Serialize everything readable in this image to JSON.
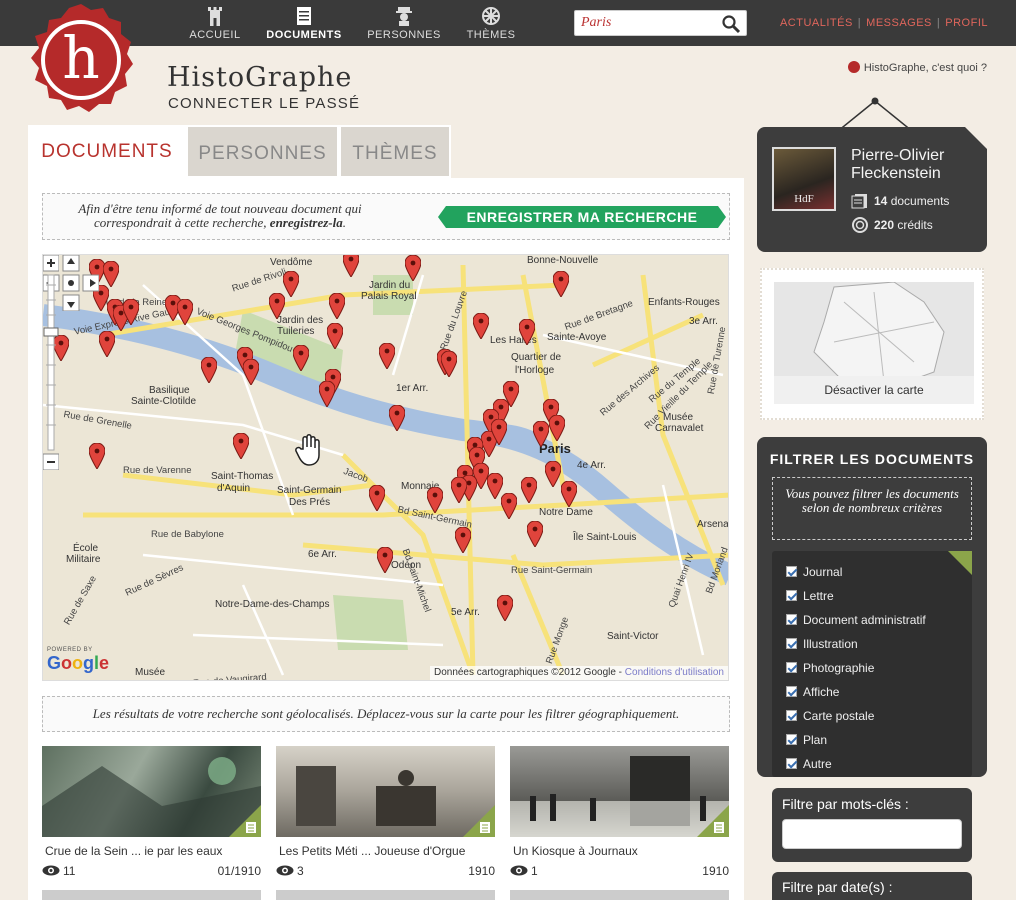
{
  "nav": {
    "items": [
      {
        "label": "ACCUEIL",
        "icon": "tower-icon"
      },
      {
        "label": "DOCUMENTS",
        "icon": "document-icon"
      },
      {
        "label": "PERSONNES",
        "icon": "person-icon"
      },
      {
        "label": "THÈMES",
        "icon": "wheel-icon"
      }
    ],
    "search_value": "Paris",
    "links": [
      "ACTUALITÉS",
      "MESSAGES",
      "PROFIL"
    ]
  },
  "header": {
    "logo_letter": "h",
    "title": "HistoGraphe",
    "subtitle": "CONNECTER LE PASSÉ",
    "whatis": "HistoGraphe, c'est quoi ?"
  },
  "tabs": [
    "DOCUMENTS",
    "PERSONNES",
    "THÈMES"
  ],
  "save": {
    "text_line1": "Afin d'être tenu informé de tout nouveau document qui",
    "text_line2": "correspondrait à cette recherche,",
    "text_emph": "enregistrez-la",
    "text_end": ".",
    "button": "ENREGISTRER MA RECHERCHE"
  },
  "map": {
    "labels": [
      {
        "t": "Vendôme",
        "c": "n"
      },
      {
        "t": "Jardin du",
        "c": "n"
      },
      {
        "t": "Palais Royal",
        "c": "n"
      },
      {
        "t": "Bonne-Nouvelle",
        "c": "n"
      },
      {
        "t": "Enfants-Rouges",
        "c": "n"
      },
      {
        "t": "3e Arr.",
        "c": "n"
      },
      {
        "t": "Sainte-Avoye",
        "c": "n"
      },
      {
        "t": "Les Halles",
        "c": "n"
      },
      {
        "t": "Quartier de",
        "c": "n"
      },
      {
        "t": "l'Horloge",
        "c": "n"
      },
      {
        "t": "Jardin des",
        "c": "n"
      },
      {
        "t": "Tuileries",
        "c": "n"
      },
      {
        "t": "1er Arr.",
        "c": "n"
      },
      {
        "t": "Basilique",
        "c": "n"
      },
      {
        "t": "Sainte-Clotilde",
        "c": "n"
      },
      {
        "t": "Paris",
        "c": "big"
      },
      {
        "t": "4e Arr.",
        "c": "n"
      },
      {
        "t": "Musée",
        "c": "n"
      },
      {
        "t": "Carnavalet",
        "c": "n"
      },
      {
        "t": "Saint-Thomas",
        "c": "n"
      },
      {
        "t": "d'Aquin",
        "c": "n"
      },
      {
        "t": "Saint-Germain",
        "c": "n"
      },
      {
        "t": "Des Prés",
        "c": "n"
      },
      {
        "t": "Monnaie",
        "c": "n"
      },
      {
        "t": "Notre Dame",
        "c": "n"
      },
      {
        "t": "Arsenal",
        "c": "n"
      },
      {
        "t": "Île Saint-Louis",
        "c": "n"
      },
      {
        "t": "6e Arr.",
        "c": "n"
      },
      {
        "t": "Odéon",
        "c": "n"
      },
      {
        "t": "Notre-Dame-des-Champs",
        "c": "n"
      },
      {
        "t": "5e Arr.",
        "c": "n"
      },
      {
        "t": "Saint-Victor",
        "c": "n"
      },
      {
        "t": "École",
        "c": "n"
      },
      {
        "t": "Militaire",
        "c": "n"
      },
      {
        "t": "Musée",
        "c": "n"
      },
      {
        "t": "Rue de Rivoli",
        "c": "street"
      },
      {
        "t": "Voie Georges Pompidou",
        "c": "street"
      },
      {
        "t": "Rue de Babylone",
        "c": "street"
      },
      {
        "t": "Bd Saint-Germain",
        "c": "street"
      },
      {
        "t": "Rue Saint-Germain",
        "c": "street"
      },
      {
        "t": "Bd Saint-Michel",
        "c": "street"
      },
      {
        "t": "Rue de Bretagne",
        "c": "street"
      },
      {
        "t": "Rue du Louvre",
        "c": "street"
      },
      {
        "t": "Rue de Turenne",
        "c": "street"
      },
      {
        "t": "Rue du Temple",
        "c": "street"
      },
      {
        "t": "Rue Vieille du Temple",
        "c": "street"
      },
      {
        "t": "Rue des Archives",
        "c": "street"
      },
      {
        "t": "Bd Morland",
        "c": "street"
      },
      {
        "t": "Quai Henri IV",
        "c": "street"
      },
      {
        "t": "Rue Monge",
        "c": "street"
      },
      {
        "t": "Rue de Sèvres",
        "c": "street"
      },
      {
        "t": "Rue de Varenne",
        "c": "street"
      },
      {
        "t": "Jacob",
        "c": "street"
      },
      {
        "t": "Rue de Grenelle",
        "c": "street"
      },
      {
        "t": "Voie Express Rive Gauche",
        "c": "street"
      },
      {
        "t": "Rue de la Reine",
        "c": "street"
      },
      {
        "t": "Rue de Saxe",
        "c": "street"
      },
      {
        "t": "Rue de Vaugirard",
        "c": "street"
      }
    ],
    "powered_by": "POWERED BY",
    "google": "Google",
    "copyright": "Données cartographiques ©2012 Google - ",
    "terms": "Conditions d'utilisation"
  },
  "geo_note": "Les résultats de votre recherche sont géolocalisés. Déplacez-vous sur la carte pour les filtrer géographiquement.",
  "results": [
    {
      "title": "Crue de la Sein ... ie par les eaux",
      "views": "11",
      "date": "01/1910"
    },
    {
      "title": "Les Petits Méti ... Joueuse d'Orgue",
      "views": "3",
      "date": "1910"
    },
    {
      "title": "Un Kiosque à Journaux",
      "views": "1",
      "date": "1910"
    }
  ],
  "profile": {
    "name_line1": "Pierre-Olivier",
    "name_line2": "Fleckenstein",
    "avatar_text": "HdF",
    "documents_count": "14",
    "documents_label": "documents",
    "credits_count": "220",
    "credits_label": "crédits"
  },
  "map_toggle": "Désactiver la carte",
  "filters": {
    "title": "FILTRER LES DOCUMENTS",
    "note": "Vous pouvez filtrer les documents selon de nombreux critères",
    "types": [
      "Journal",
      "Lettre",
      "Document administratif",
      "Illustration",
      "Photographie",
      "Affiche",
      "Carte postale",
      "Plan",
      "Autre"
    ],
    "keywords_label": "Filtre par mots-clés :",
    "dates_label": "Filtre par date(s) :"
  },
  "colors": {
    "accent_red": "#b8332e",
    "topbar": "#3a3a3a",
    "green_button": "#22a35e",
    "fold_green": "#8ba54a",
    "marker": "#e0443c"
  }
}
